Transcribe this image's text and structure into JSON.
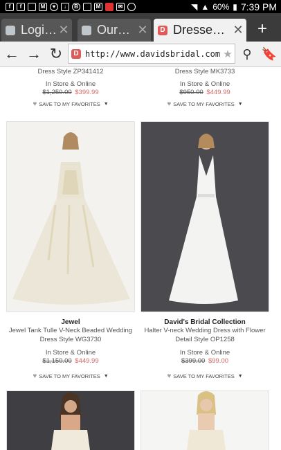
{
  "status_bar": {
    "battery": "60%",
    "time": "7:39 PM"
  },
  "tabs": [
    {
      "title": "Logi…",
      "active": false
    },
    {
      "title": "Our…",
      "active": false
    },
    {
      "title": "Dresse…",
      "active": true
    }
  ],
  "new_tab": "+",
  "address": {
    "url": "http://www.davidsbridal.com/Search"
  },
  "products_top": [
    {
      "style_line": "Dress Style ZP341412",
      "availability": "In Store & Online",
      "old_price": "$1,250.00",
      "new_price": "$399.99",
      "favorites": "SAVE TO MY FAVORITES"
    },
    {
      "style_line": "Dress Style MK3733",
      "availability": "In Store & Online",
      "old_price": "$950.00",
      "new_price": "$449.99",
      "favorites": "SAVE TO MY FAVORITES"
    }
  ],
  "products_mid": [
    {
      "brand": "Jewel",
      "name_line1": "Jewel Tank Tulle V-Neck Beaded Wedding",
      "name_line2": "Dress Style WG3730",
      "availability": "In Store & Online",
      "old_price": "$1,150.00",
      "new_price": "$449.99",
      "favorites": "SAVE TO MY FAVORITES"
    },
    {
      "brand": "David's Bridal Collection",
      "name_line1": "Halter V-neck Wedding Dress with Flower",
      "name_line2": "Detail Style OP1258",
      "availability": "In Store & Online",
      "old_price": "$399.00",
      "new_price": "$99.00",
      "favorites": "SAVE TO MY FAVORITES"
    }
  ]
}
